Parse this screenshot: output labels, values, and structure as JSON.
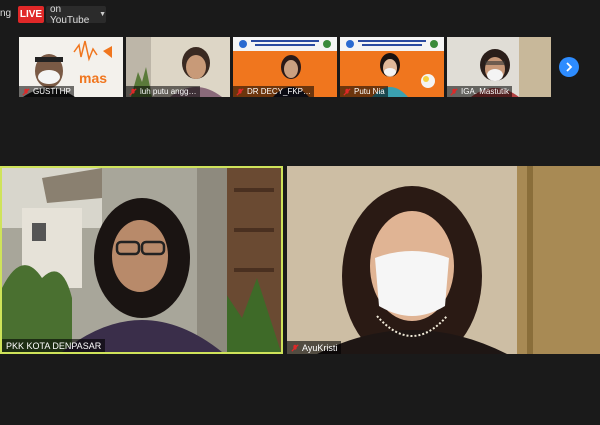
{
  "status": {
    "text": "ng"
  },
  "live": {
    "badge": "LIVE",
    "destination": "on YouTube"
  },
  "participants_strip": [
    {
      "name": "GUSTI HP",
      "muted": true
    },
    {
      "name": "luh putu angg…",
      "muted": true
    },
    {
      "name": "DR DECY_FKP…",
      "muted": true
    },
    {
      "name": "Putu Nia",
      "muted": true
    },
    {
      "name": "IGA. Mastutik",
      "muted": true
    }
  ],
  "banner_text": "mas",
  "main_speakers": [
    {
      "name": "PKK KOTA DENPASAR",
      "active": true
    },
    {
      "name": "AyuKristi",
      "muted": true
    }
  ],
  "colors": {
    "live": "#e02828",
    "active_border": "#cfe35a",
    "accent": "#2d8cff",
    "banner": "#f0761e"
  },
  "icons": {
    "mute": "mic-muted-icon",
    "next": "chevron-right-icon",
    "dropdown": "chevron-down-icon"
  }
}
